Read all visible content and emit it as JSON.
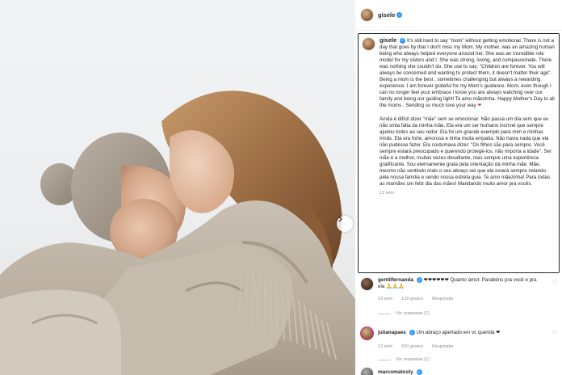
{
  "post": {
    "author": "gisele",
    "caption_en": "It's still hard to say \"mom\" without getting emotional. There is not a day that goes by that I don't miss my Mom. My mother, was an amazing human being who always helped everyone around her. She was an incredible role model for my sisters and I. She was strong, loving, and compassionate. There was nothing she couldn't do. She use to say: \"Children are forever. You will always be concerned and wanting to protect them, it doesn't matter their age\". Being a mom is the best , sometimes challenging but always a rewarding experience. I am forever grateful for my Mom's guidance. Mom, even though I can no longer feel your embrace I know you are always watching over our family and being our guiding light! Te amo mãezinha. Happy Mother's Day to all the moms . Sending so much love your way",
    "caption_pt": "Ainda é difícil dizer \"mãe\" sem se emocionar. Não passa um dia sem que eu não sinta falta da minha mãe. Ela era um ser humano incrível que sempre ajudou todos ao seu redor. Ela foi um grande exemplo para mim e minhas irmãs. Ela era forte, amorosa e tinha muita empatia. Não havia nada que ela não pudesse fazer. Ela costumava dizer: \"Os filhos são para sempre. Você sempre estará preocupado e querendo protegê-los, não importa a idade\". Ser mãe é a melhor, muitas vezes desafiante, mas sempre uma experiência gratificante. Sou eternamente grata pela orientação da minha mãe. Mãe, mesmo não sentindo mais o seu abraço sei que ela estará sempre zelando pela nossa família e sendo nossa estrela guia. Te amo mãezinha! Para todas as mamães um feliz dia das mães! Mandando muito amor pra vocês.",
    "caption_heart": "❤",
    "time": "13 sem"
  },
  "comments": [
    {
      "user": "gentilfernanda",
      "text": "❤❤❤❤❤❤ Quanto amor. Parabéns pra você e pra ela 🙏🙏🙏",
      "time": "13 sem",
      "likes": "129 gostos",
      "reply": "Responder",
      "view_replies": "Ver respostas (1)"
    },
    {
      "user": "julianapaes",
      "text": "Um abraço apertado em vc querida ❤",
      "time": "13 sem",
      "likes": "420 gostos",
      "reply": "Responder",
      "view_replies": "Ver respostas (1)"
    },
    {
      "user": "marcomatosty",
      "text": ""
    }
  ],
  "icons": {
    "verified": "verified-badge-icon",
    "like": "heart-outline-icon",
    "next": "chevron-right-icon"
  },
  "colors": {
    "verified": "#3897f0",
    "heart": "#ed4956",
    "muted": "#8e8e8e"
  }
}
